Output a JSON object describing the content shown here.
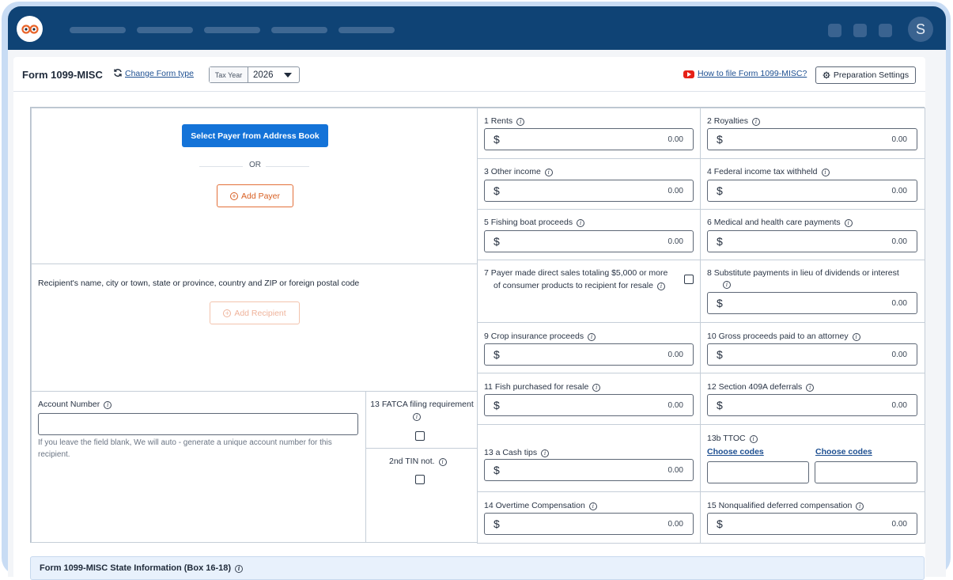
{
  "app": {
    "avatar_initial": "S",
    "colors": {
      "header": "#0f4375",
      "primary": "#1473d8",
      "accent": "#e3703a",
      "link": "#1d4f91"
    }
  },
  "header": {
    "form_title": "Form 1099-MISC",
    "change_form_type": "Change Form type",
    "tax_year_label": "Tax Year",
    "tax_year_value": "2026",
    "how_to_link": "How to file Form 1099-MISC?",
    "prep_settings": "Preparation Settings"
  },
  "payer": {
    "select_button": "Select Payer from Address Book",
    "or_text": "OR",
    "add_button": "Add Payer"
  },
  "recipient": {
    "label": "Recipient's name, city or town, state or province, country and ZIP or foreign postal code",
    "add_button": "Add Recipient"
  },
  "account": {
    "label": "Account Number",
    "value": "",
    "hint": "If you leave the field blank, We will auto - generate a unique account number for this recipient."
  },
  "fatca": {
    "label": "13 FATCA filing requirement"
  },
  "tin": {
    "label": "2nd TIN not."
  },
  "boxes": {
    "b1": {
      "label": "1  Rents",
      "currency": "$",
      "value": "0.00"
    },
    "b2": {
      "label": "2  Royalties",
      "currency": "$",
      "value": "0.00"
    },
    "b3": {
      "label": "3  Other income",
      "currency": "$",
      "value": "0.00"
    },
    "b4": {
      "label": "4  Federal income tax withheld",
      "currency": "$",
      "value": "0.00"
    },
    "b5": {
      "label": "5  Fishing boat proceeds",
      "currency": "$",
      "value": "0.00"
    },
    "b6": {
      "label": "6   Medical and health care payments",
      "currency": "$",
      "value": "0.00"
    },
    "b7": {
      "line1": "7  Payer made direct sales totaling $5,000 or more",
      "line2": "of consumer products to recipient for resale"
    },
    "b8": {
      "label": "8  Substitute payments in lieu of dividends or interest",
      "currency": "$",
      "value": "0.00"
    },
    "b9": {
      "label": "9  Crop insurance proceeds",
      "currency": "$",
      "value": "0.00"
    },
    "b10": {
      "label": "10  Gross proceeds paid to an attorney",
      "currency": "$",
      "value": "0.00"
    },
    "b11": {
      "label": "11  Fish purchased for resale",
      "currency": "$",
      "value": "0.00"
    },
    "b12": {
      "label": "12  Section 409A deferrals",
      "currency": "$",
      "value": "0.00"
    },
    "b13a": {
      "label": "13 a  Cash tips",
      "currency": "$",
      "value": "0.00"
    },
    "b13b": {
      "label": "13b  TTOC",
      "choose1": "Choose codes",
      "choose2": "Choose codes"
    },
    "b14": {
      "label": "14  Overtime Compensation",
      "currency": "$",
      "value": "0.00"
    },
    "b15": {
      "label": "15  Nonqualified deferred compensation",
      "currency": "$",
      "value": "0.00"
    }
  },
  "state_section": {
    "title": "Form 1099-MISC State Information  (Box 16-18)"
  }
}
